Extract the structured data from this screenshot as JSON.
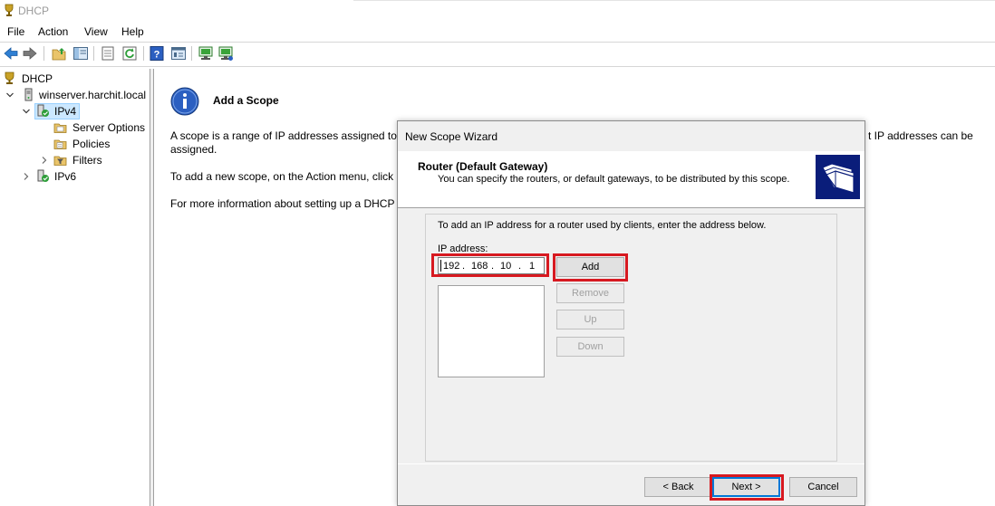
{
  "window": {
    "title": "DHCP"
  },
  "menu": {
    "file": "File",
    "action": "Action",
    "view": "View",
    "help": "Help"
  },
  "toolbar": {
    "icons": [
      "back-arrow-icon",
      "forward-arrow-icon",
      "up-folder-icon",
      "show-hide-tree-icon",
      "export-list-icon",
      "refresh-icon",
      "help-icon",
      "properties-icon",
      "server-icon-a",
      "server-icon-b"
    ]
  },
  "tree": {
    "root": "DHCP",
    "server": "winserver.harchit.local",
    "ipv4": "IPv4",
    "server_options": "Server Options",
    "policies": "Policies",
    "filters": "Filters",
    "ipv6": "IPv6"
  },
  "content": {
    "heading": "Add a Scope",
    "para1_left": "A scope is a range of IP addresses assigned to co",
    "para1_right": "t IP addresses can be",
    "para1_line2": "assigned.",
    "para2": "To add a new scope, on the Action menu, click I",
    "para3": "For more information about setting up a DHCP"
  },
  "wizard": {
    "title": "New Scope Wizard",
    "header_title": "Router (Default Gateway)",
    "header_subtitle": "You can specify the routers, or default gateways, to be distributed by this scope.",
    "intro": "To add an IP address for a router used by clients, enter the address below.",
    "ip_label": "IP address:",
    "ip": {
      "o1": "192",
      "o2": "168",
      "o3": "10",
      "o4": "1"
    },
    "buttons": {
      "add": "Add",
      "remove": "Remove",
      "up": "Up",
      "down": "Down",
      "back": "< Back",
      "next": "Next >",
      "cancel": "Cancel"
    }
  },
  "colors": {
    "highlight": "#d71920",
    "selection": "#cce8ff",
    "header_icon_bg": "#0a1d7a"
  }
}
